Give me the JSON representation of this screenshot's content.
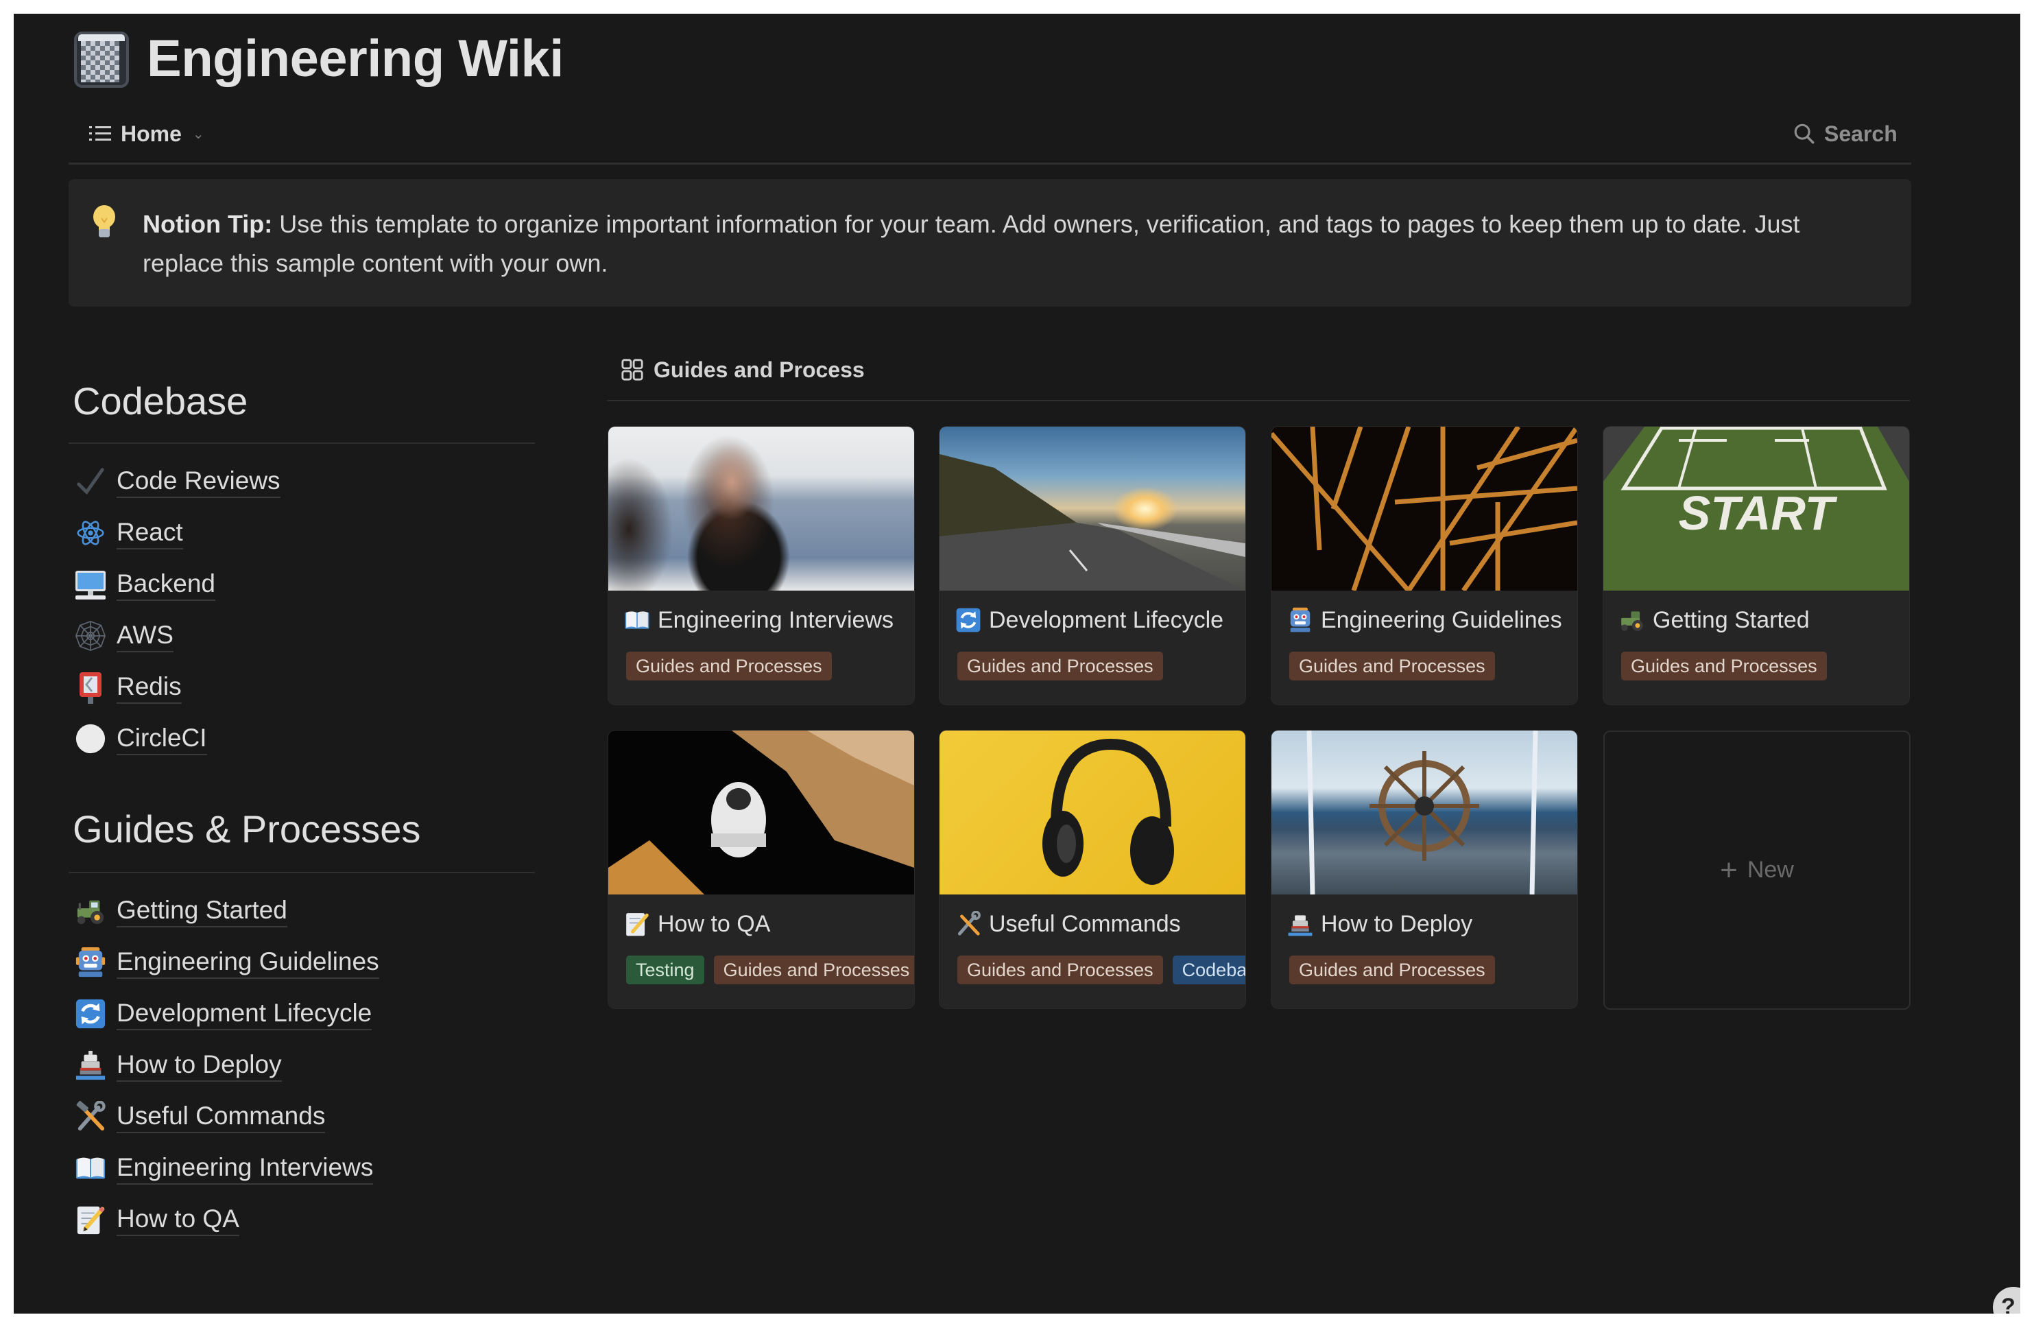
{
  "page": {
    "title": "Engineering Wiki",
    "title_icon": "wiki-book-icon"
  },
  "nav": {
    "home_label": "Home",
    "home_icon": "list-icon",
    "search_label": "Search",
    "search_icon": "search-icon"
  },
  "callout": {
    "icon": "lightbulb-icon",
    "bold_label": "Notion Tip:",
    "text": " Use this template to organize important information for your team. Add owners, verification, and tags to pages to keep them up to date. Just replace this sample content with your own."
  },
  "codebase": {
    "heading": "Codebase",
    "items": [
      {
        "label": "Code Reviews",
        "icon": "checkmark-icon"
      },
      {
        "label": "React",
        "icon": "atom-icon"
      },
      {
        "label": "Backend",
        "icon": "desktop-computer-icon"
      },
      {
        "label": "AWS",
        "icon": "spider-web-icon"
      },
      {
        "label": "Redis",
        "icon": "postbox-icon"
      },
      {
        "label": "CircleCI",
        "icon": "white-circle-icon"
      }
    ]
  },
  "guides": {
    "heading": "Guides & Processes",
    "items": [
      {
        "label": "Getting Started",
        "icon": "tractor-icon"
      },
      {
        "label": "Engineering Guidelines",
        "icon": "robot-icon"
      },
      {
        "label": "Development Lifecycle",
        "icon": "cycle-arrows-icon"
      },
      {
        "label": "How to Deploy",
        "icon": "ship-icon"
      },
      {
        "label": "Useful Commands",
        "icon": "hammer-wrench-icon"
      },
      {
        "label": "Engineering Interviews",
        "icon": "open-book-icon"
      },
      {
        "label": "How to QA",
        "icon": "memo-icon"
      }
    ]
  },
  "gallery": {
    "title": "Guides and Process",
    "icon": "gallery-grid-icon",
    "cards": [
      {
        "title": "Engineering Interviews",
        "icon": "open-book-icon",
        "cover": "interview-photo",
        "tags": [
          {
            "label": "Guides and Processes",
            "color": "#5a3a2c"
          }
        ]
      },
      {
        "title": "Development Lifecycle",
        "icon": "cycle-arrows-icon",
        "cover": "mountain-road-sunset-photo",
        "tags": [
          {
            "label": "Guides and Processes",
            "color": "#5a3a2c"
          }
        ]
      },
      {
        "title": "Engineering Guidelines",
        "icon": "robot-icon",
        "cover": "steel-girders-photo",
        "tags": [
          {
            "label": "Guides and Processes",
            "color": "#5a3a2c"
          }
        ]
      },
      {
        "title": "Getting Started",
        "icon": "tractor-icon",
        "cover": "start-line-turf-photo",
        "tags": [
          {
            "label": "Guides and Processes",
            "color": "#5a3a2c"
          }
        ]
      },
      {
        "title": "How to QA",
        "icon": "memo-icon",
        "cover": "astronaut-spacewalk-photo",
        "tags": [
          {
            "label": "Testing",
            "color": "#2b5a3b"
          },
          {
            "label": "Guides and Processes",
            "color": "#5a3a2c"
          }
        ]
      },
      {
        "title": "Useful Commands",
        "icon": "hammer-wrench-icon",
        "cover": "headphones-yellow-photo",
        "tags": [
          {
            "label": "Guides and Processes",
            "color": "#5a3a2c"
          },
          {
            "label": "Codebase",
            "color": "#254a73"
          }
        ]
      },
      {
        "title": "How to Deploy",
        "icon": "ship-icon",
        "cover": "ship-wheel-photo",
        "tags": [
          {
            "label": "Guides and Processes",
            "color": "#5a3a2c"
          }
        ]
      }
    ],
    "new_label": "New"
  },
  "colors": {
    "background": "#191919",
    "callout_bg": "#252525",
    "card_bg": "#252525",
    "tag_brown": "#5a3a2c",
    "tag_green": "#2b5a3b",
    "tag_blue": "#254a73"
  }
}
